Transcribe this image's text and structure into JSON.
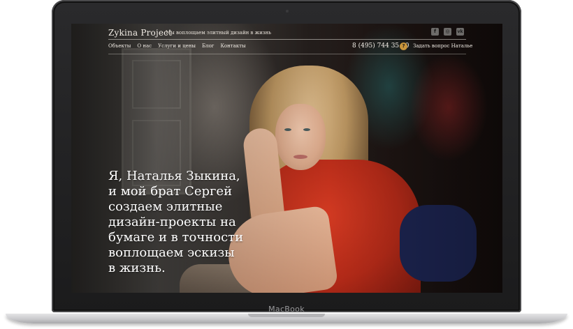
{
  "device": {
    "label": "MacBook"
  },
  "header": {
    "logo": "Zykina Project",
    "tagline": "Мы воплощаем элитный дизайн в жизнь",
    "social": [
      {
        "icon": "facebook-icon",
        "glyph": "f"
      },
      {
        "icon": "instagram-icon",
        "glyph": "◎"
      },
      {
        "icon": "vk-icon",
        "glyph": "vk"
      }
    ],
    "nav": [
      "Объекты",
      "О нас",
      "Услуги и цены",
      "Блог",
      "Контакты"
    ],
    "phone": "8 (495) 744 35 40",
    "question_glyph": "?",
    "ask_label": "Задать вопрос Наталье"
  },
  "hero": {
    "headline_lines": [
      "Я, Наталья Зыкина,",
      "и мой брат Сергей",
      "создаем элитные",
      "дизайн-проекты на",
      "бумаге и в точности",
      "воплощаем эскизы",
      "в жизнь."
    ]
  },
  "colors": {
    "accent": "#c9953b",
    "text_light": "#f2ede6"
  }
}
